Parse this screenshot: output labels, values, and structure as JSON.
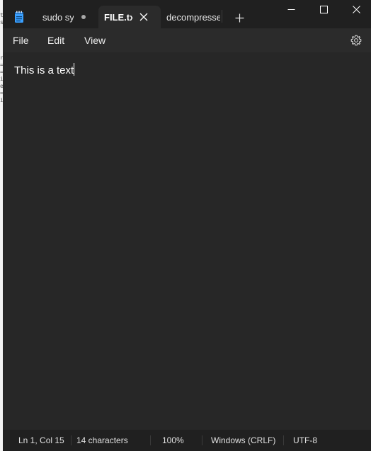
{
  "app": {
    "tabs": [
      {
        "label": "sudo sy",
        "modified": true
      },
      {
        "label": "FILE.txt",
        "active": true
      },
      {
        "label": "decompressed"
      }
    ]
  },
  "menu": {
    "file": "File",
    "edit": "Edit",
    "view": "View"
  },
  "editor": {
    "content": "This is a text"
  },
  "status": {
    "position": "Ln 1, Col 15",
    "characters": "14 characters",
    "zoom": "100%",
    "line_ending": "Windows (CRLF)",
    "encoding": "UTF-8"
  },
  "background": {
    "fragments": [
      "t",
      "s",
      "",
      "r",
      "=",
      "=",
      "i",
      "",
      "e",
      "",
      "=",
      "i"
    ]
  }
}
